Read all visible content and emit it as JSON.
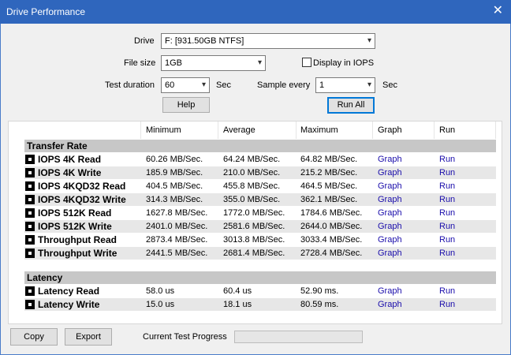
{
  "window": {
    "title": "Drive Performance",
    "close_glyph": "✕"
  },
  "form": {
    "drive_label": "Drive",
    "drive_value": "F: [931.50GB NTFS]",
    "filesize_label": "File size",
    "filesize_value": "1GB",
    "display_iops_label": "Display in IOPS",
    "display_iops_checked": false,
    "duration_label": "Test duration",
    "duration_value": "60",
    "duration_unit": "Sec",
    "sample_label": "Sample every",
    "sample_value": "1",
    "sample_unit": "Sec",
    "dropdown_glyph": "▾"
  },
  "buttons": {
    "help": "Help",
    "run_all": "Run All",
    "copy": "Copy",
    "export": "Export"
  },
  "table": {
    "columns": {
      "minimum": "Minimum",
      "average": "Average",
      "maximum": "Maximum",
      "graph": "Graph",
      "run": "Run"
    },
    "transfer_section": "Transfer Rate",
    "transfer_rows": [
      {
        "name": "IOPS 4K Read",
        "min": "60.26 MB/Sec.",
        "avg": "64.24 MB/Sec.",
        "max": "64.82 MB/Sec.",
        "graph": "Graph",
        "run": "Run"
      },
      {
        "name": "IOPS 4K Write",
        "min": "185.9 MB/Sec.",
        "avg": "210.0 MB/Sec.",
        "max": "215.2 MB/Sec.",
        "graph": "Graph",
        "run": "Run"
      },
      {
        "name": "IOPS 4KQD32 Read",
        "min": "404.5 MB/Sec.",
        "avg": "455.8 MB/Sec.",
        "max": "464.5 MB/Sec.",
        "graph": "Graph",
        "run": "Run"
      },
      {
        "name": "IOPS 4KQD32 Write",
        "min": "314.3 MB/Sec.",
        "avg": "355.0 MB/Sec.",
        "max": "362.1 MB/Sec.",
        "graph": "Graph",
        "run": "Run"
      },
      {
        "name": "IOPS 512K Read",
        "min": "1627.8 MB/Sec.",
        "avg": "1772.0 MB/Sec.",
        "max": "1784.6 MB/Sec.",
        "graph": "Graph",
        "run": "Run"
      },
      {
        "name": "IOPS 512K Write",
        "min": "2401.0 MB/Sec.",
        "avg": "2581.6 MB/Sec.",
        "max": "2644.0 MB/Sec.",
        "graph": "Graph",
        "run": "Run"
      },
      {
        "name": "Throughput Read",
        "min": "2873.4 MB/Sec.",
        "avg": "3013.8 MB/Sec.",
        "max": "3033.4 MB/Sec.",
        "graph": "Graph",
        "run": "Run"
      },
      {
        "name": "Throughput Write",
        "min": "2441.5 MB/Sec.",
        "avg": "2681.4 MB/Sec.",
        "max": "2728.4 MB/Sec.",
        "graph": "Graph",
        "run": "Run"
      }
    ],
    "latency_section": "Latency",
    "latency_rows": [
      {
        "name": "Latency Read",
        "min": "58.0 us",
        "avg": "60.4 us",
        "max": "52.90 ms.",
        "graph": "Graph",
        "run": "Run"
      },
      {
        "name": "Latency Write",
        "min": "15.0 us",
        "avg": "18.1 us",
        "max": "80.59 ms.",
        "graph": "Graph",
        "run": "Run"
      }
    ]
  },
  "footer": {
    "progress_label": "Current Test Progress",
    "progress_percent": 0
  }
}
